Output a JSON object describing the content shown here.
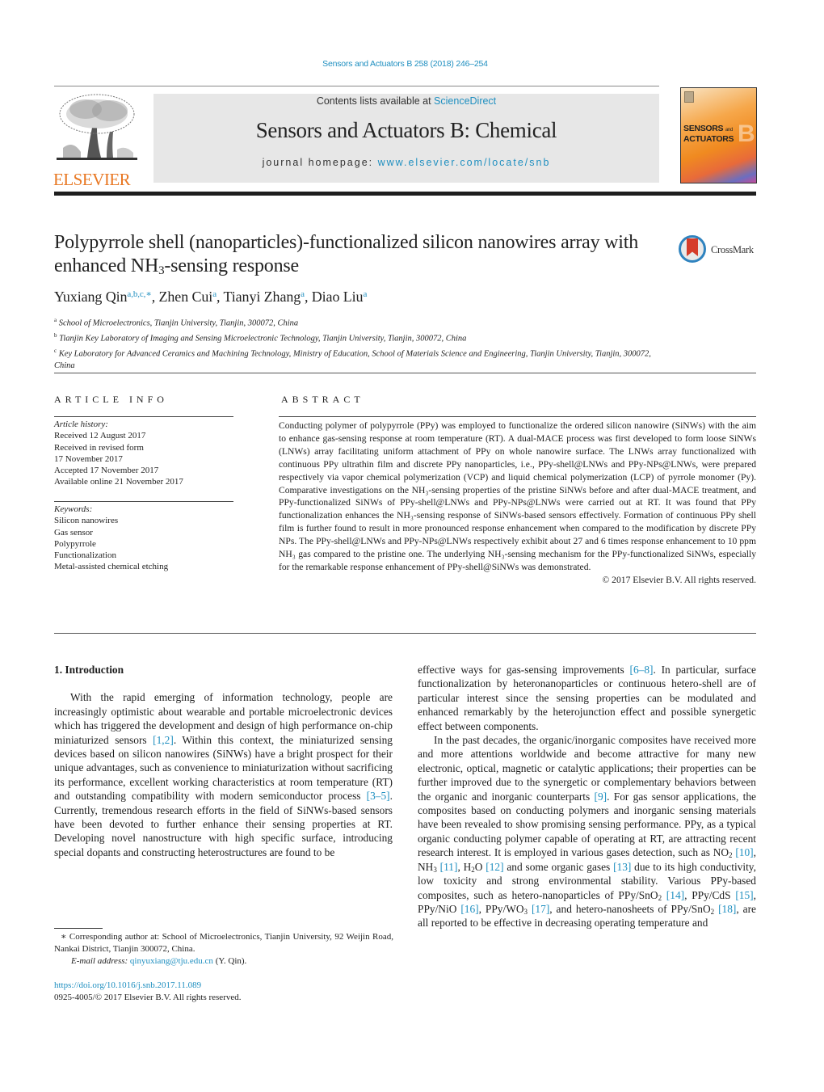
{
  "header": {
    "journal_reference": "Sensors and Actuators B 258 (2018) 246–254",
    "contents_prefix": "Contents lists available at ",
    "contents_link": "ScienceDirect",
    "journal_title": "Sensors and Actuators B: Chemical",
    "homepage_prefix": "journal homepage: ",
    "homepage_link": "www.elsevier.com/locate/snb",
    "publisher_logo_text": "ELSEVIER",
    "cover_title_line1": "SENSORS",
    "cover_title_and": "and",
    "cover_title_line2": "ACTUATORS",
    "cover_letter": "B",
    "crossmark_label": "CrossMark",
    "colors": {
      "link": "#1f8fc0",
      "elsevier_orange": "#e87722",
      "banner_bg": "#e7e7e7"
    }
  },
  "article": {
    "title_part1": "Polypyrrole shell (nanoparticles)-functionalized silicon nanowires array with enhanced NH",
    "title_sub": "3",
    "title_part2": "-sensing response",
    "authors": [
      {
        "name": "Yuxiang Qin",
        "marks": "a,b,c,∗"
      },
      {
        "name": "Zhen Cui",
        "marks": "a"
      },
      {
        "name": "Tianyi Zhang",
        "marks": "a"
      },
      {
        "name": "Diao Liu",
        "marks": "a"
      }
    ],
    "affiliations": [
      {
        "mark": "a",
        "text": "School of Microelectronics, Tianjin University, Tianjin, 300072, China"
      },
      {
        "mark": "b",
        "text": "Tianjin Key Laboratory of Imaging and Sensing Microelectronic Technology, Tianjin University, Tianjin, 300072, China"
      },
      {
        "mark": "c",
        "text": "Key Laboratory for Advanced Ceramics and Machining Technology, Ministry of Education, School of Materials Science and Engineering, Tianjin University, Tianjin, 300072, China"
      }
    ]
  },
  "article_info": {
    "heading": "ARTICLE INFO",
    "history_label": "Article history:",
    "history": [
      "Received 12 August 2017",
      "Received in revised form",
      "17 November 2017",
      "Accepted 17 November 2017",
      "Available online 21 November 2017"
    ],
    "keywords_label": "Keywords:",
    "keywords": [
      "Silicon nanowires",
      "Gas sensor",
      "Polypyrrole",
      "Functionalization",
      "Metal-assisted chemical etching"
    ]
  },
  "abstract": {
    "heading": "ABSTRACT",
    "text": "Conducting polymer of polypyrrole (PPy) was employed to functionalize the ordered silicon nanowire (SiNWs) with the aim to enhance gas-sensing response at room temperature (RT). A dual-MACE process was first developed to form loose SiNWs (LNWs) array facilitating uniform attachment of PPy on whole nanowire surface. The LNWs array functionalized with continuous PPy ultrathin film and discrete PPy nanoparticles, i.e., PPy-shell@LNWs and PPy-NPs@LNWs, were prepared respectively via vapor chemical polymerization (VCP) and liquid chemical polymerization (LCP) of pyrrole monomer (Py). Comparative investigations on the NH₃-sensing properties of the pristine SiNWs before and after dual-MACE treatment, and PPy-functionalized SiNWs of PPy-shell@LNWs and PPy-NPs@LNWs were carried out at RT. It was found that PPy functionalization enhances the NH₃-sensing response of SiNWs-based sensors effectively. Formation of continuous PPy shell film is further found to result in more pronounced response enhancement when compared to the modification by discrete PPy NPs. The PPy-shell@LNWs and PPy-NPs@LNWs respectively exhibit about 27 and 6 times response enhancement to 10 ppm NH₃ gas compared to the pristine one. The underlying NH₃-sensing mechanism for the PPy-functionalized SiNWs, especially for the remarkable response enhancement of PPy-shell@SiNWs was demonstrated.",
    "copyright": "© 2017 Elsevier B.V. All rights reserved."
  },
  "body": {
    "section_heading": "1.  Introduction",
    "left_p1": [
      {
        "t": "With the rapid emerging of information technology, people are increasingly optimistic about wearable and portable microelectronic devices which has triggered the development and design of high performance on-chip miniaturized sensors "
      },
      {
        "ref": "[1,2]"
      },
      {
        "t": ". Within this context, the miniaturized sensing devices based on silicon nanowires (SiNWs) have a bright prospect for their unique advantages, such as convenience to miniaturization without sacrificing its performance, excellent working characteristics at room temperature (RT) and outstanding compatibility with modern semiconductor process "
      },
      {
        "ref": "[3–5]"
      },
      {
        "t": ". Currently, tremendous research efforts in the field of SiNWs-based sensors have been devoted to further enhance their sensing properties at RT. Developing novel nanostructure with high specific surface, introducing special dopants and constructing heterostructures are found to be"
      }
    ],
    "right_p1": [
      {
        "t": "effective ways for gas-sensing improvements "
      },
      {
        "ref": "[6–8]"
      },
      {
        "t": ". In particular, surface functionalization by heteronanoparticles or continuous hetero-shell are of particular interest since the sensing properties can be modulated and enhanced remarkably by the heterojunction effect and possible synergetic effect between components."
      }
    ],
    "right_p2": [
      {
        "t": "In the past decades, the organic/inorganic composites have received more and more attentions worldwide and become attractive for many new electronic, optical, magnetic or catalytic applications; their properties can be further improved due to the synergetic or complementary behaviors between the organic and inorganic counterparts "
      },
      {
        "ref": "[9]"
      },
      {
        "t": ". For gas sensor applications, the composites based on conducting polymers and inorganic sensing materials have been revealed to show promising sensing performance. PPy, as a typical organic conducting polymer capable of operating at RT, are attracting recent research interest. It is employed in various gases detection, such as NO"
      },
      {
        "sub": "2"
      },
      {
        "t": " "
      },
      {
        "ref": "[10]"
      },
      {
        "t": ", NH"
      },
      {
        "sub": "3"
      },
      {
        "t": " "
      },
      {
        "ref": "[11]"
      },
      {
        "t": ", H"
      },
      {
        "sub": "2"
      },
      {
        "t": "O "
      },
      {
        "ref": "[12]"
      },
      {
        "t": " and some organic gases "
      },
      {
        "ref": "[13]"
      },
      {
        "t": " due to its high conductivity, low toxicity and strong environmental stability. Various PPy-based composites, such as hetero-nanoparticles of PPy/SnO"
      },
      {
        "sub": "2"
      },
      {
        "t": " "
      },
      {
        "ref": "[14]"
      },
      {
        "t": ", PPy/CdS "
      },
      {
        "ref": "[15]"
      },
      {
        "t": ", PPy/NiO "
      },
      {
        "ref": "[16]"
      },
      {
        "t": ", PPy/WO"
      },
      {
        "sub": "3"
      },
      {
        "t": " "
      },
      {
        "ref": "[17]"
      },
      {
        "t": ", and hetero-nanosheets of PPy/SnO"
      },
      {
        "sub": "2"
      },
      {
        "t": " "
      },
      {
        "ref": "[18]"
      },
      {
        "t": ", are all reported to be effective in decreasing operating temperature and"
      }
    ]
  },
  "footer": {
    "corresponding_note": "∗ Corresponding author at: School of Microelectronics, Tianjin University, 92 Weijin Road, Nankai District, Tianjin 300072, China.",
    "email_label": "E-mail address:",
    "email": "qinyuxiang@tju.edu.cn",
    "email_suffix": " (Y. Qin).",
    "doi": "https://doi.org/10.1016/j.snb.2017.11.089",
    "issn_line": "0925-4005/© 2017 Elsevier B.V. All rights reserved."
  }
}
